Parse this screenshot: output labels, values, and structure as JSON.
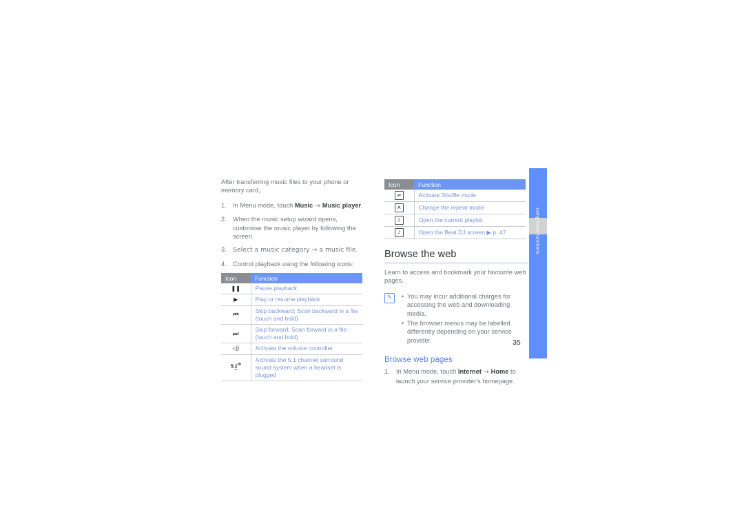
{
  "page": {
    "number": "35",
    "side_tab_label": "using basic functions",
    "accent_blue": "#5f8ffa",
    "link_blue": "#7b93d6",
    "heading_color": "#2b2e31",
    "subheading_color": "#5a7fe0",
    "body_color": "#6f7378",
    "table_header_icon_bg": "#8a8d92",
    "table_header_function_bg": "#6c95f5"
  },
  "left_column": {
    "intro": "After transferring music files to your phone or memory card,",
    "steps": [
      {
        "num": "1.",
        "parts": [
          {
            "t": "In Menu mode, touch "
          },
          {
            "t": "Music",
            "bold": true
          },
          {
            "t": " → "
          },
          {
            "t": "Music player",
            "bold": true
          },
          {
            "t": "."
          }
        ]
      },
      {
        "num": "2.",
        "parts": [
          {
            "t": "When the music setup wizard opens, customise the music player by following the screen."
          }
        ]
      },
      {
        "num": "3.",
        "parts": [
          {
            "t": "Select a music category → a music file."
          }
        ]
      },
      {
        "num": "4.",
        "parts": [
          {
            "t": "Control playback using the following icons:"
          }
        ]
      }
    ],
    "table": {
      "headers": {
        "icon": "Icon",
        "function": "Function"
      },
      "rows": [
        {
          "icon": "pause-icon",
          "glyph": "❚❚",
          "function": "Pause playback"
        },
        {
          "icon": "play-icon",
          "glyph": "▶",
          "function": "Play or resume playback"
        },
        {
          "icon": "skip-backward-icon",
          "glyph": "⏮",
          "function": "Skip backward; Scan backward in a file (touch and hold)"
        },
        {
          "icon": "skip-forward-icon",
          "glyph": "⏭",
          "function": "Skip forward; Scan forward in a file (touch and hold)"
        },
        {
          "icon": "volume-icon",
          "glyph": "◁)",
          "function": "Activate the volume controller"
        },
        {
          "icon": "surround-51ch-icon",
          "glyph": "5.1ch",
          "function": "Activate the 5.1 channel surround sound system when a headset is plugged"
        }
      ]
    }
  },
  "right_column": {
    "table": {
      "headers": {
        "icon": "Icon",
        "function": "Function"
      },
      "rows": [
        {
          "icon": "shuffle-icon",
          "glyph": "⇄",
          "function": "Activate Shuffle mode"
        },
        {
          "icon": "repeat-icon",
          "glyph": "A",
          "function": "Change the repeat mode"
        },
        {
          "icon": "playlist-icon",
          "glyph": "♫",
          "function": "Open the current playlist"
        },
        {
          "icon": "beat-dj-icon",
          "glyph": "♪",
          "function": "Open the Beat DJ screen ▶ p. 47"
        }
      ]
    },
    "heading": "Browse the web",
    "lead": "Learn to access and bookmark your favourite web pages.",
    "note": {
      "icon": "note-pencil-icon",
      "items": [
        "You may incur additional charges for accessing the web and downloading media.",
        "The browser menus may be labelled differently depending on your service provider."
      ]
    },
    "subheading": "Browse web pages",
    "steps": [
      {
        "num": "1.",
        "parts": [
          {
            "t": "In Menu mode, touch "
          },
          {
            "t": "Internet",
            "bold": true
          },
          {
            "t": " → "
          },
          {
            "t": "Home",
            "bold": true
          },
          {
            "t": " to launch your service provider's homepage."
          }
        ]
      }
    ]
  }
}
